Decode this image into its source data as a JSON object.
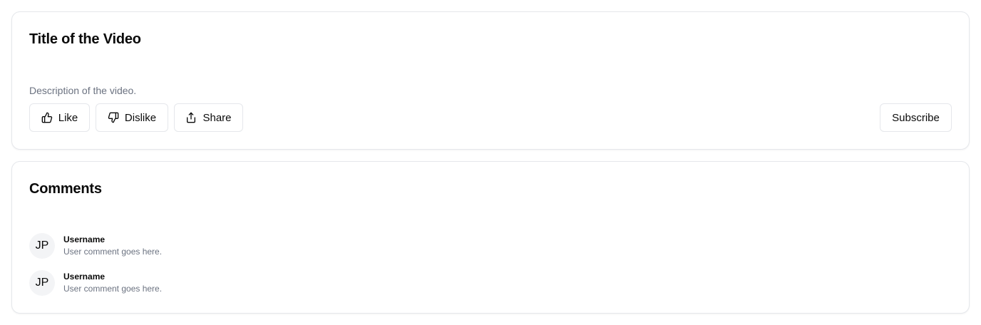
{
  "video": {
    "title": "Title of the Video",
    "description": "Description of the video.",
    "actions": {
      "like_label": "Like",
      "like_icon": "thumbs-up-icon",
      "dislike_label": "Dislike",
      "dislike_icon": "thumbs-down-icon",
      "share_label": "Share",
      "share_icon": "share-icon",
      "subscribe_label": "Subscribe"
    }
  },
  "comments": {
    "title": "Comments",
    "items": [
      {
        "initials": "JP",
        "username": "Username",
        "text": "User comment goes here."
      },
      {
        "initials": "JP",
        "username": "Username",
        "text": "User comment goes here."
      }
    ]
  },
  "colors": {
    "border": "#e5e7eb",
    "muted_text": "#6b7280",
    "avatar_bg": "#f3f4f6",
    "text": "#0a0a0a"
  }
}
